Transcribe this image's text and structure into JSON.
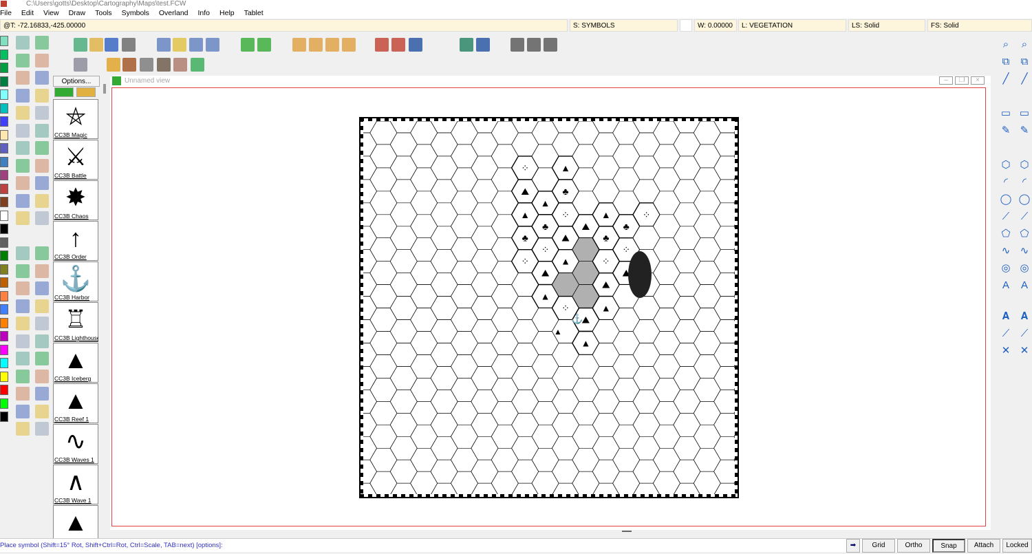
{
  "window": {
    "title": "C:\\Users\\gotts\\Desktop\\Cartography\\Maps\\test.FCW"
  },
  "menu": [
    "File",
    "Edit",
    "View",
    "Draw",
    "Tools",
    "Symbols",
    "Overland",
    "Info",
    "Help",
    "Tablet"
  ],
  "status": {
    "coords": "@T: -72.16833,-425.00000",
    "sheet": "S: SYMBOLS",
    "width": "W: 0.00000",
    "layer": "L: VEGETATION",
    "line_style": "LS: Solid",
    "fill_style": "FS: Solid"
  },
  "symbols": {
    "options_label": "Options...",
    "items": [
      {
        "label": "CC3B Magic",
        "glyph": "⛤"
      },
      {
        "label": "CC3B Battle",
        "glyph": "⚔"
      },
      {
        "label": "CC3B Chaos",
        "glyph": "✸"
      },
      {
        "label": "CC3B Order",
        "glyph": "↑"
      },
      {
        "label": "CC3B Harbor",
        "glyph": "⚓"
      },
      {
        "label": "CC3B Lighthouse",
        "glyph": "♖"
      },
      {
        "label": "CC3B Iceberg",
        "glyph": "▲"
      },
      {
        "label": "CC3B Reef 1",
        "glyph": "▲"
      },
      {
        "label": "CC3B Waves 1",
        "glyph": "∿"
      },
      {
        "label": "CC3B Wave 1",
        "glyph": "∧"
      },
      {
        "label": "",
        "glyph": "▲"
      }
    ]
  },
  "view": {
    "title": "Unnamed view"
  },
  "palette": [
    "#80e0c0",
    "#00c060",
    "#00a040",
    "#008040",
    "#80ffff",
    "#00c0c0",
    "#4040ff",
    "#ffe8b0",
    "#6060c0",
    "#4080c0",
    "#a04080",
    "#c04040",
    "#804020",
    "#ffffff",
    "#000000",
    "#606060",
    "#008000",
    "#808020",
    "#c06000",
    "#ff8040",
    "#4080ff",
    "#ff8000",
    "#c000c0",
    "#ff00ff",
    "#00ffff",
    "#ffff00",
    "#ff0000",
    "#00ff00",
    "#000000"
  ],
  "prompt": "Place symbol (Shift=15° Rot, Shift+Ctrl=Rot, Ctrl=Scale, TAB=next) [options]:",
  "bottom_buttons": {
    "grid": "Grid",
    "ortho": "Ortho",
    "snap": "Snap",
    "attach": "Attach",
    "locked": "Locked"
  },
  "map": {
    "grid": "hex",
    "shaded_hex_color": "#b0b0b0"
  }
}
